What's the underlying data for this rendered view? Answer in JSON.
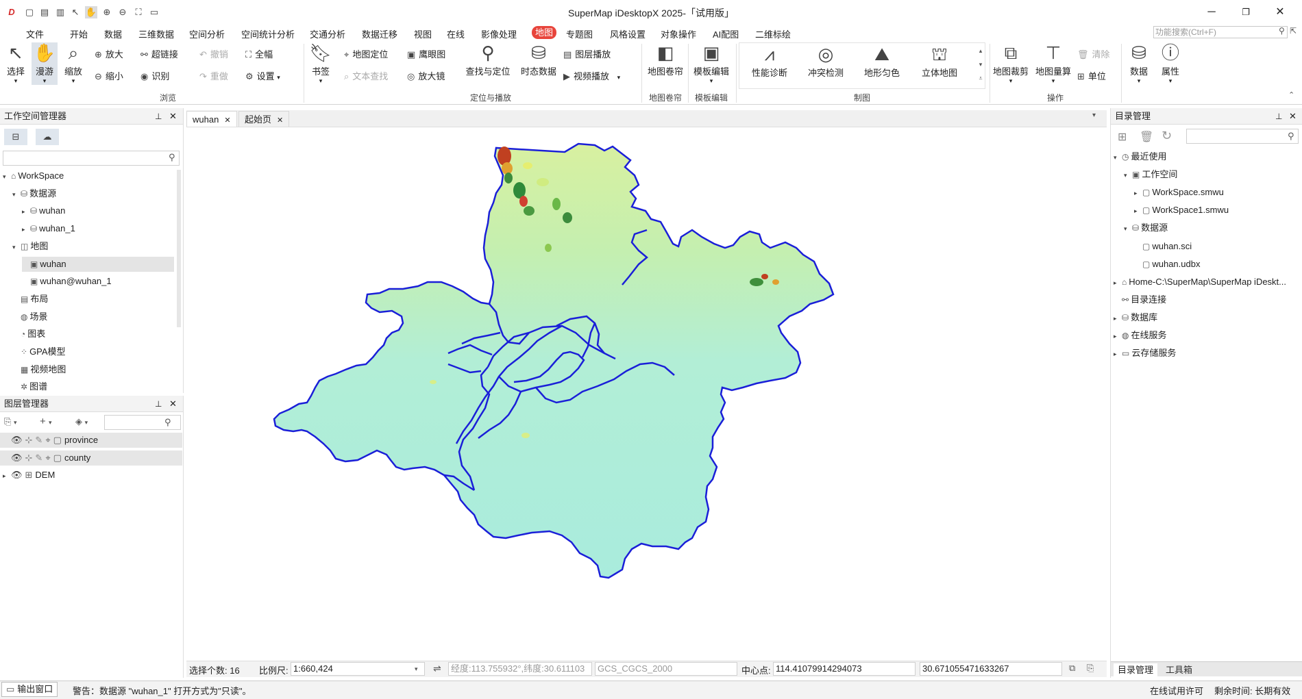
{
  "app": {
    "title": "SuperMap iDesktopX 2025-「试用版」"
  },
  "menus": [
    "文件",
    "开始",
    "数据",
    "三维数据",
    "空间分析",
    "空间统计分析",
    "交通分析",
    "数据迁移",
    "视图",
    "在线",
    "影像处理",
    "地图",
    "专题图",
    "风格设置",
    "对象操作",
    "AI配图",
    "二维标绘"
  ],
  "menu_active": "地图",
  "function_search": {
    "placeholder": "功能搜索(Ctrl+F)"
  },
  "ribbon": {
    "select": "选择",
    "pan": "漫游",
    "zoom": "缩放",
    "zoom_in": "放大",
    "zoom_out": "缩小",
    "hyperlink": "超链接",
    "identify": "识别",
    "undo": "撤销",
    "redo": "重做",
    "full_extent": "全幅",
    "settings": "设置",
    "browse_group": "浏览",
    "bookmark": "书签",
    "map_locate": "地图定位",
    "text_search": "文本查找",
    "eagle_eye": "鹰眼图",
    "magnifier": "放大镜",
    "find_locate": "查找与定位",
    "temporal": "时态数据",
    "layer_play": "图层播放",
    "video_play": "视频播放",
    "locate_group": "定位与播放",
    "map_swipe": "地图卷帘",
    "swipe_group": "地图卷帘",
    "template_edit": "模板编辑",
    "template_group": "模板编辑",
    "perf_diag": "性能诊断",
    "conflict": "冲突检测",
    "terrain_color": "地形匀色",
    "stereo_map": "立体地图",
    "draw_group": "制图",
    "map_clip": "地图裁剪",
    "map_measure": "地图量算",
    "clear": "清除",
    "unit": "单位",
    "ops_group": "操作",
    "data": "数据",
    "attributes": "属性"
  },
  "workspace_manager": {
    "title": "工作空间管理器",
    "items": [
      {
        "label": "WorkSpace",
        "depth": 0,
        "arrow": "▾",
        "icon": "⌂"
      },
      {
        "label": "数据源",
        "depth": 1,
        "arrow": "▾",
        "icon": "⛁"
      },
      {
        "label": "wuhan",
        "depth": 2,
        "arrow": "▸",
        "icon": "⛁"
      },
      {
        "label": "wuhan_1",
        "depth": 2,
        "arrow": "▸",
        "icon": "⛁"
      },
      {
        "label": "地图",
        "depth": 1,
        "arrow": "▾",
        "icon": "◫"
      },
      {
        "label": "wuhan",
        "depth": 2,
        "arrow": "",
        "icon": "▣",
        "selected": true
      },
      {
        "label": "wuhan@wuhan_1",
        "depth": 2,
        "arrow": "",
        "icon": "▣"
      },
      {
        "label": "布局",
        "depth": 1,
        "arrow": "",
        "icon": "▤"
      },
      {
        "label": "场景",
        "depth": 1,
        "arrow": "",
        "icon": "◍"
      },
      {
        "label": "图表",
        "depth": 1,
        "arrow": "",
        "icon": "◔"
      },
      {
        "label": "GPA模型",
        "depth": 1,
        "arrow": "",
        "icon": "⁘"
      },
      {
        "label": "视频地图",
        "depth": 1,
        "arrow": "",
        "icon": "▦"
      },
      {
        "label": "图谱",
        "depth": 1,
        "arrow": "",
        "icon": "✲"
      }
    ]
  },
  "layer_manager": {
    "title": "图层管理器",
    "layers": [
      {
        "name": "province",
        "arrow": ""
      },
      {
        "name": "county",
        "arrow": ""
      },
      {
        "name": "DEM",
        "arrow": "▸"
      }
    ]
  },
  "tabs": [
    {
      "label": "wuhan",
      "active": true
    },
    {
      "label": "起始页",
      "active": false
    }
  ],
  "catalog": {
    "title": "目录管理",
    "items": [
      {
        "label": "最近使用",
        "depth": 0,
        "arrow": "▾",
        "icon": "◷"
      },
      {
        "label": "工作空间",
        "depth": 1,
        "arrow": "▾",
        "icon": "▣"
      },
      {
        "label": "WorkSpace.smwu",
        "depth": 2,
        "arrow": "▸",
        "icon": "▢"
      },
      {
        "label": "WorkSpace1.smwu",
        "depth": 2,
        "arrow": "▸",
        "icon": "▢"
      },
      {
        "label": "数据源",
        "depth": 1,
        "arrow": "▾",
        "icon": "⛁"
      },
      {
        "label": "wuhan.sci",
        "depth": 2,
        "arrow": "",
        "icon": "▢"
      },
      {
        "label": "wuhan.udbx",
        "depth": 2,
        "arrow": "",
        "icon": "▢"
      },
      {
        "label": "Home-C:\\SuperMap\\SuperMap iDeskt...",
        "depth": 0,
        "arrow": "▸",
        "icon": "⌂"
      },
      {
        "label": "目录连接",
        "depth": 0,
        "arrow": "",
        "icon": "⚯"
      },
      {
        "label": "数据库",
        "depth": 0,
        "arrow": "▸",
        "icon": "⛁"
      },
      {
        "label": "在线服务",
        "depth": 0,
        "arrow": "▸",
        "icon": "◍"
      },
      {
        "label": "云存储服务",
        "depth": 0,
        "arrow": "▸",
        "icon": "▭"
      }
    ],
    "bottom_tabs": [
      "目录管理",
      "工具箱"
    ]
  },
  "status": {
    "selected_count": "选择个数: 16",
    "scale_label": "比例尺:",
    "scale_value": "1:660,424",
    "coord": "经度:113.755932°,纬度:30.611103",
    "crs": "GCS_CGCS_2000",
    "center_label": "中心点:",
    "center_x": "114.41079914294073",
    "center_y": "30.671055471633267"
  },
  "bottom": {
    "output_window": "输出窗口",
    "warning": "警告：数据源 \"wuhan_1\" 打开方式为\"只读\"。",
    "license": "在线试用许可",
    "remaining": "剩余时间: 长期有效"
  },
  "colors": {
    "boundary": "#1a1fd8",
    "dem_low": "#aeeedd",
    "accent": "#e8453c"
  }
}
